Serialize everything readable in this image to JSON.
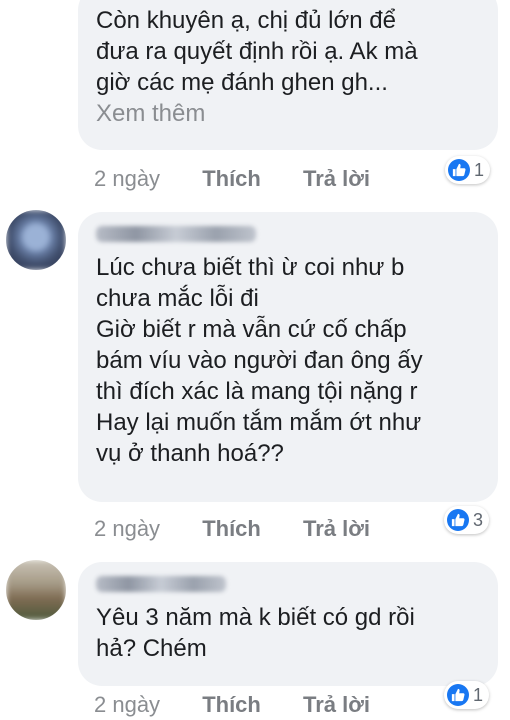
{
  "comments": [
    {
      "lines": [
        "Còn khuyên ạ, chị đủ lớn để",
        "đưa ra quyết định rồi ạ. Ak mà",
        "giờ các mẹ đánh ghen gh..."
      ],
      "see_more": "Xem thêm",
      "time": "2 ngày",
      "like_label": "Thích",
      "reply_label": "Trả lời",
      "reaction_count": "1"
    },
    {
      "lines": [
        "Lúc chưa biết thì ừ coi như b",
        "chưa mắc lỗi đi",
        "Giờ biết r mà vẫn cứ cố chấp",
        "bám víu vào người đan ông ấy",
        "thì đích xác là mang tội nặng r",
        "Hay lại muốn tắm mắm ớt như",
        "vụ ở thanh hoá??"
      ],
      "time": "2 ngày",
      "like_label": "Thích",
      "reply_label": "Trả lời",
      "reaction_count": "3"
    },
    {
      "lines": [
        "Yêu 3 năm mà k biết có gd rồi",
        "hả? Chém"
      ],
      "time": "2 ngày",
      "like_label": "Thích",
      "reply_label": "Trả lời",
      "reaction_count": "1"
    }
  ],
  "colors": {
    "bubble": "#f0f2f5",
    "like_blue": "#1877f2",
    "meta_gray": "#8a8d91"
  },
  "icons": [
    "like-icon"
  ]
}
